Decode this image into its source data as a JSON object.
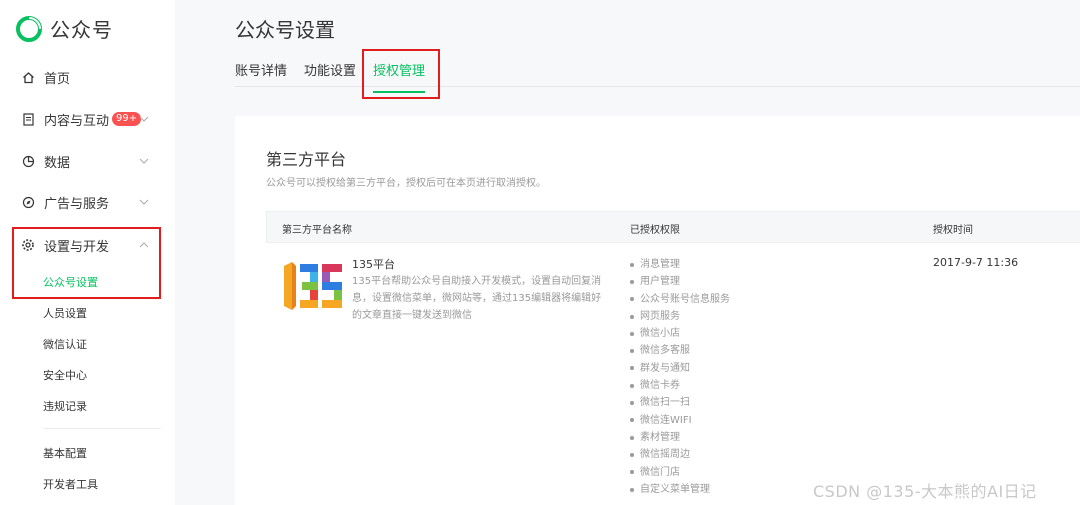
{
  "app": {
    "logo_text": "公众号"
  },
  "sidebar": {
    "items": [
      {
        "label": "首页",
        "icon": "home-icon"
      },
      {
        "label": "内容与互动",
        "badge": "99+",
        "icon": "document-icon"
      },
      {
        "label": "数据",
        "icon": "chart-pie-icon"
      },
      {
        "label": "广告与服务",
        "icon": "compass-icon"
      },
      {
        "label": "设置与开发",
        "icon": "gear-icon"
      }
    ],
    "sub_items": [
      "公众号设置",
      "人员设置",
      "微信认证",
      "安全中心",
      "违规记录"
    ],
    "tools": [
      "基本配置",
      "开发者工具"
    ]
  },
  "main": {
    "title": "公众号设置",
    "tabs": [
      {
        "label": "账号详情"
      },
      {
        "label": "功能设置"
      },
      {
        "label": "授权管理"
      }
    ],
    "section_title": "第三方平台",
    "section_desc": "公众号可以授权给第三方平台，授权后可在本页进行取消授权。",
    "table": {
      "headers": [
        "第三方平台名称",
        "已授权权限",
        "授权时间"
      ],
      "row": {
        "name": "135平台",
        "desc": "135平台帮助公众号自助接入开发模式，设置自动回复消息，设置微信菜单，微网站等，通过135编辑器将编辑好的文章直接一键发送到微信",
        "permissions": [
          "消息管理",
          "用户管理",
          "公众号账号信息服务",
          "网页服务",
          "微信小店",
          "微信多客服",
          "群发与通知",
          "微信卡券",
          "微信扫一扫",
          "微信连WIFI",
          "素材管理",
          "微信摇周边",
          "微信门店",
          "自定义菜单管理"
        ],
        "time": "2017-9-7 11:36"
      }
    }
  },
  "watermark": "CSDN @135-大本熊的AI日记",
  "colors": {
    "accent": "#07c160",
    "badge": "#fa5151",
    "highlight_box": "#e11d1d"
  }
}
